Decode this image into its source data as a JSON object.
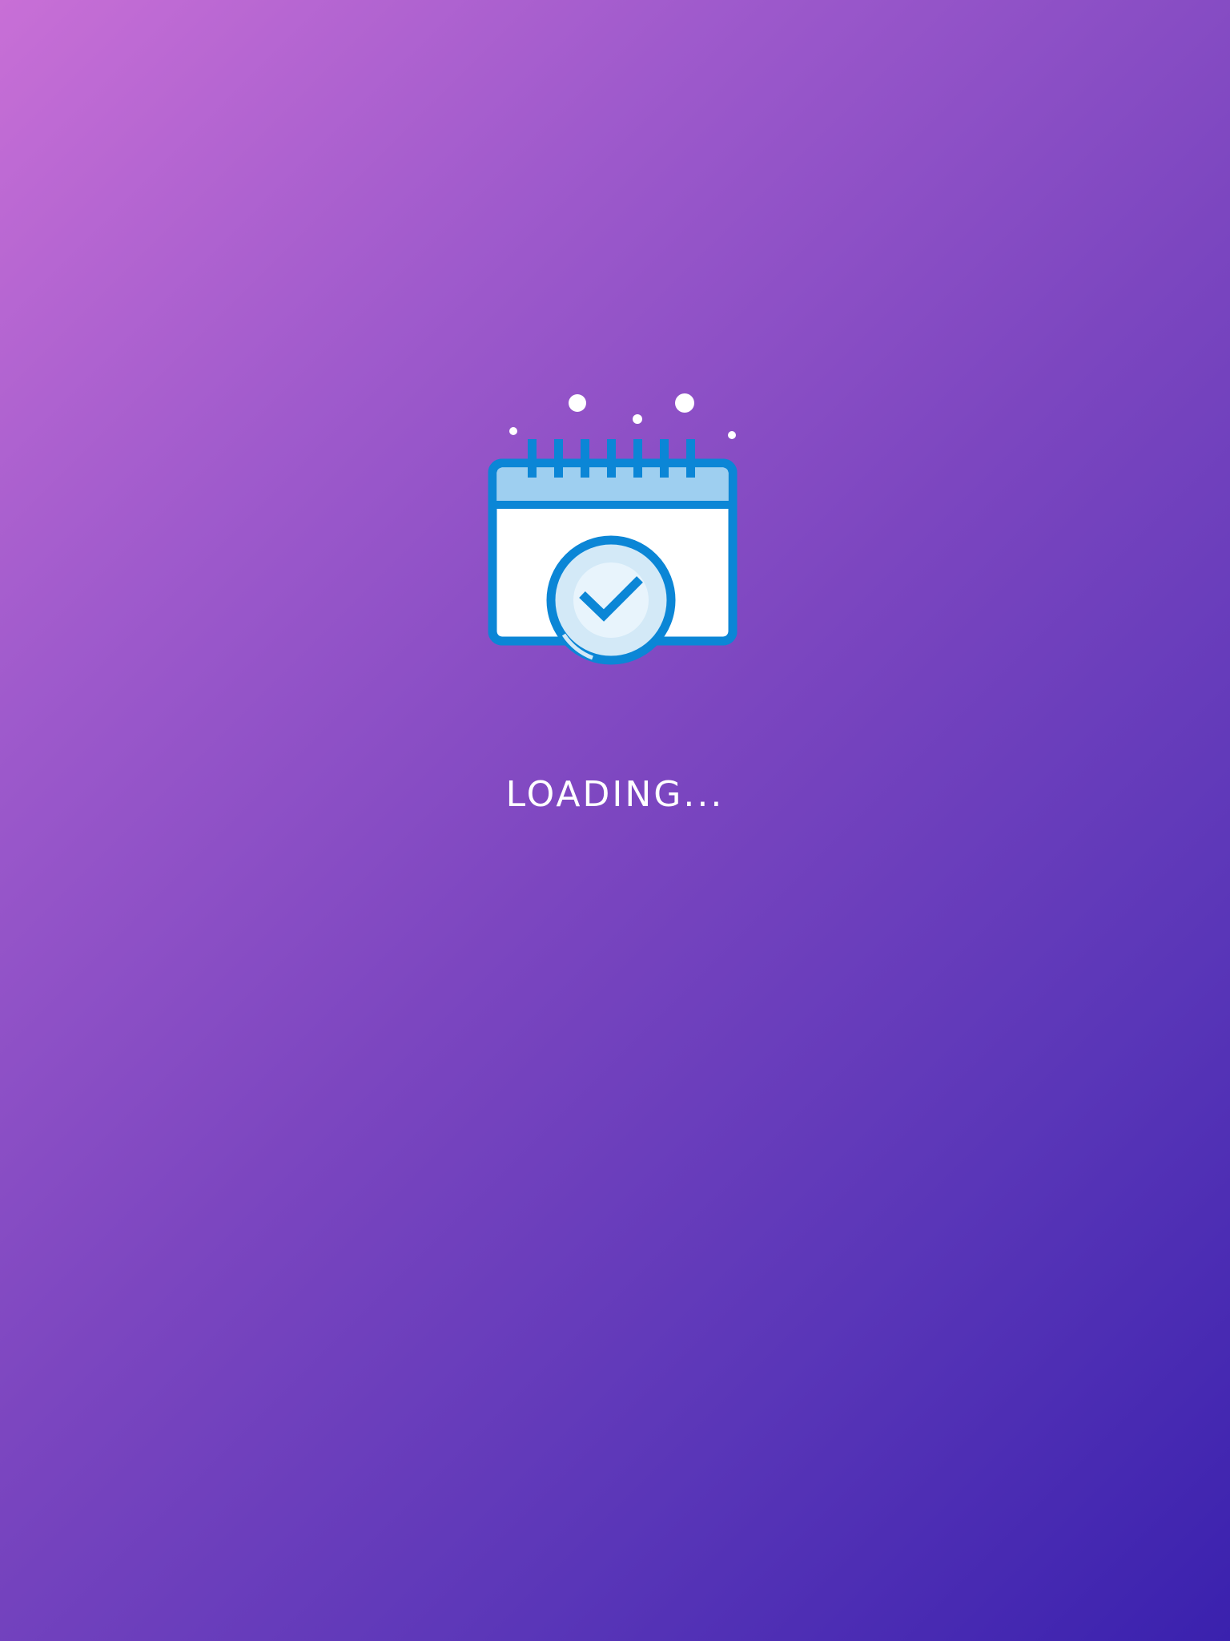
{
  "splash": {
    "status_text": "LOADING...",
    "icon": "calendar-check-icon"
  },
  "colors": {
    "gradient_start": "#c86fd6",
    "gradient_end": "#3a21ae",
    "icon_stroke": "#0b86d6",
    "icon_header_fill": "#9ecff0",
    "icon_body_fill": "#ffffff",
    "icon_badge_fill": "#d3e9f7",
    "text": "#ffffff"
  }
}
